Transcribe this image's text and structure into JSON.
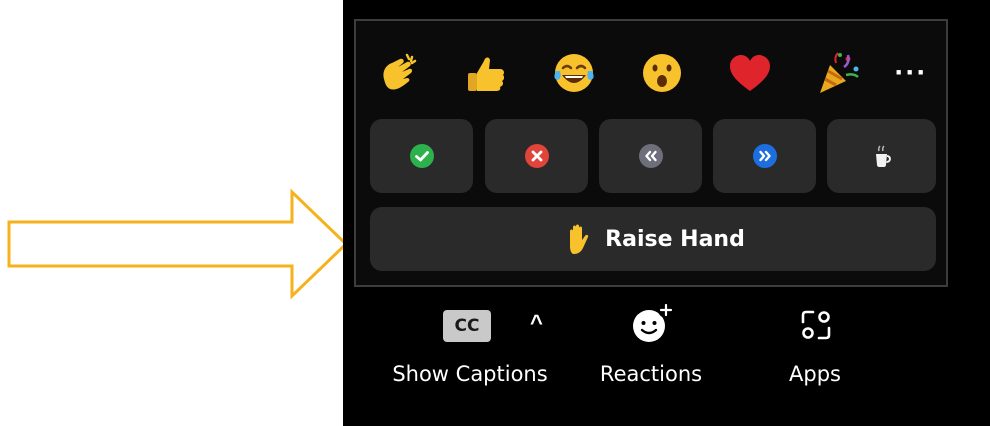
{
  "reactions_popup": {
    "emojis": [
      {
        "name": "clapping-hands",
        "icon": "clap-icon"
      },
      {
        "name": "thumbs-up",
        "icon": "thumbs-up-icon"
      },
      {
        "name": "tears-of-joy",
        "icon": "laughing-tears-icon"
      },
      {
        "name": "open-mouth",
        "icon": "surprised-face-icon"
      },
      {
        "name": "heart",
        "icon": "heart-icon"
      },
      {
        "name": "party-popper",
        "icon": "tada-icon"
      }
    ],
    "more_label": "···",
    "status_buttons": [
      {
        "name": "yes",
        "icon": "check-icon",
        "color": "#2db14c"
      },
      {
        "name": "no",
        "icon": "x-icon",
        "color": "#e0443a"
      },
      {
        "name": "slower",
        "icon": "rewind-icon",
        "color": "#6e6f7b"
      },
      {
        "name": "faster",
        "icon": "fast-forward-icon",
        "color": "#1d6fe0"
      },
      {
        "name": "coffee",
        "icon": "coffee-cup-icon"
      }
    ],
    "raise_hand_label": "Raise Hand"
  },
  "toolbar": {
    "captions": {
      "badge": "CC",
      "caret": "^",
      "label": "Show Captions"
    },
    "reactions": {
      "label": "Reactions"
    },
    "apps": {
      "label": "Apps"
    }
  },
  "colors": {
    "arrow": "#f5b21b",
    "panel": "#0b0b0b",
    "button": "#2a2a2a",
    "emoji_yellow": "#f8c22d"
  }
}
